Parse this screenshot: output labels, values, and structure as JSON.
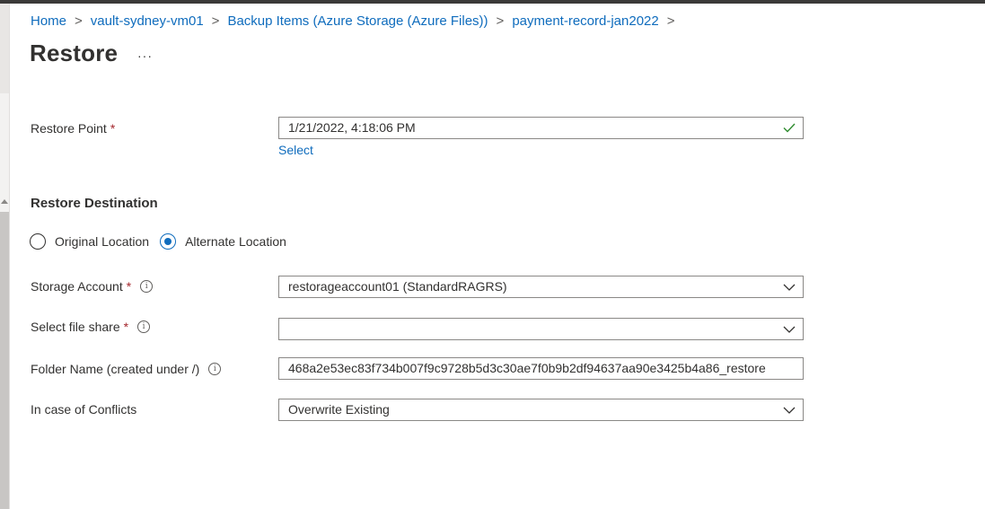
{
  "breadcrumb": [
    "Home",
    "vault-sydney-vm01",
    "Backup Items (Azure Storage (Azure Files))",
    "payment-record-jan2022"
  ],
  "page": {
    "title": "Restore",
    "more_label": "···"
  },
  "restore_point": {
    "label": "Restore Point",
    "required": "*",
    "value": "1/21/2022, 4:18:06 PM",
    "select_link": "Select",
    "valid_icon": "checkmark-icon"
  },
  "destination": {
    "heading": "Restore Destination",
    "options": [
      {
        "label": "Original Location",
        "selected": false
      },
      {
        "label": "Alternate Location",
        "selected": true
      }
    ]
  },
  "storage_account": {
    "label": "Storage Account",
    "required": "*",
    "value": "restorageaccount01 (StandardRAGRS)"
  },
  "file_share": {
    "label": "Select file share",
    "required": "*",
    "value": ""
  },
  "folder_name": {
    "label": "Folder Name (created under /)",
    "value": "468a2e53ec83f734b007f9c9728b5d3c30ae7f0b9b2df94637aa90e3425b4a86_restore"
  },
  "conflicts": {
    "label": "In case of Conflicts",
    "value": "Overwrite Existing"
  },
  "colors": {
    "link": "#0f6cbd",
    "required": "#a4262c",
    "valid": "#2e8b2e",
    "text": "#323130"
  }
}
